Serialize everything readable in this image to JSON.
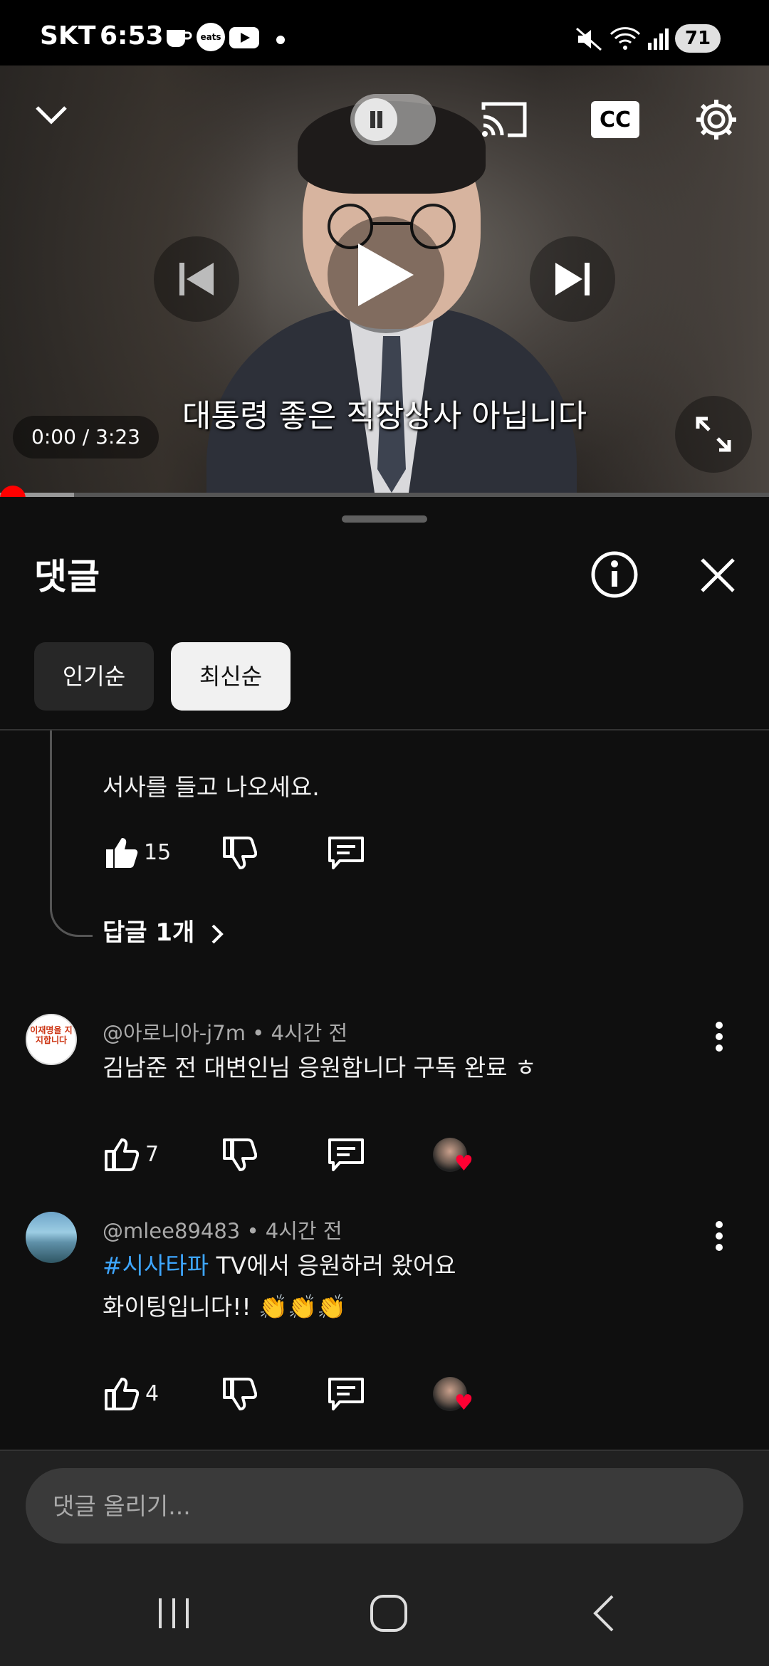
{
  "status_bar": {
    "carrier": "SKT",
    "time": "6:53",
    "notification_icons": [
      "coffee-cup-icon",
      "coupang-eats-icon",
      "youtube-icon",
      "dot-icon"
    ],
    "coupang_label": "eats",
    "battery": "71"
  },
  "player": {
    "subtitle": "대통령 좋은 직장상사 아닙니다",
    "time": "0:00 / 3:23",
    "cc_label": "CC",
    "progress": 0.0
  },
  "comments": {
    "title": "댓글",
    "sort_chips": [
      {
        "label": "인기순",
        "selected": false
      },
      {
        "label": "최신순",
        "selected": true
      }
    ],
    "partial": {
      "text_line": "서사를 들고 나오세요.",
      "likes": "15",
      "replies_link": "답글 1개"
    },
    "items": [
      {
        "handle": "@아로니아-j7m",
        "time": "4시간 전",
        "avatar_text": "이재명을 지지합니다",
        "text": "김남준 전 대변인님 응원합니다 구독 완료 ㅎ",
        "likes": "7"
      },
      {
        "handle": "@mlee89483",
        "time": "4시간 전",
        "hashtag": "#시사타파",
        "text_line1": " TV에서 응원하러 왔어요",
        "text_line2": "화이팅입니다!! 👏👏👏",
        "likes": "4"
      }
    ],
    "input_placeholder": "댓글 올리기..."
  },
  "colors": {
    "background": "#0f0f0f",
    "progress_red": "#ff0000",
    "hashtag_blue": "#3ea6ff",
    "heart_red": "#ff0033"
  }
}
